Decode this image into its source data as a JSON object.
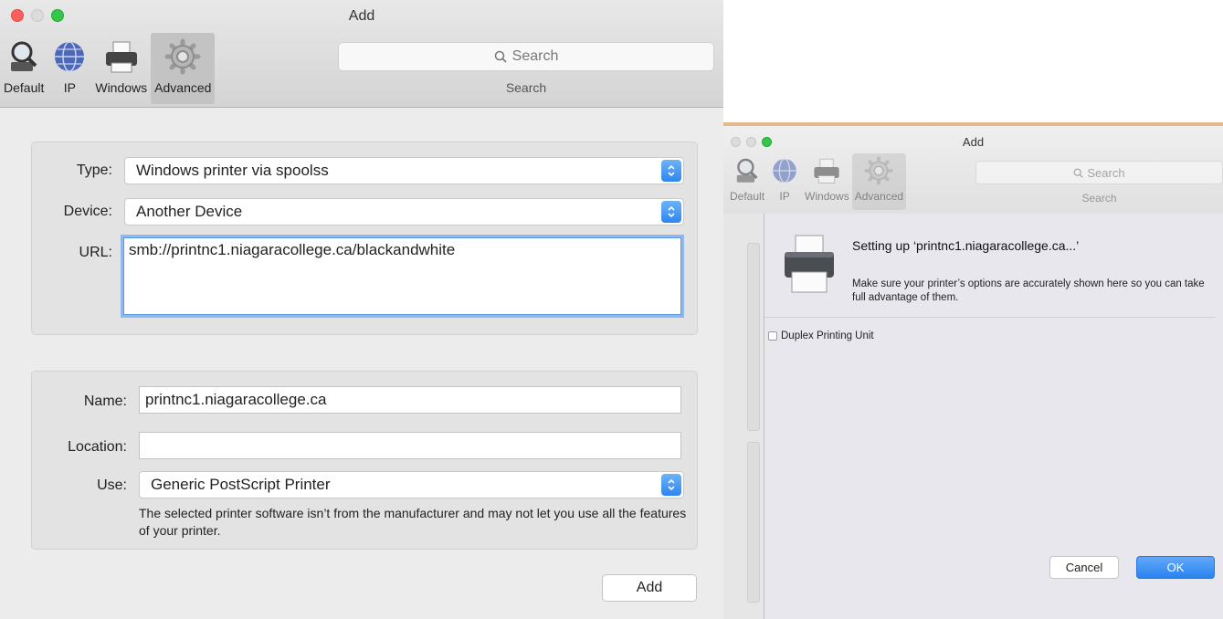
{
  "left_window": {
    "title": "Add",
    "toolbar": [
      {
        "label": "Default",
        "icon": "magnifier-icon"
      },
      {
        "label": "IP",
        "icon": "globe-icon"
      },
      {
        "label": "Windows",
        "icon": "printer-icon"
      },
      {
        "label": "Advanced",
        "icon": "gear-icon",
        "active": true
      }
    ],
    "search": {
      "placeholder": "Search",
      "caption": "Search"
    },
    "type": {
      "label": "Type:",
      "value": "Windows printer via spoolss"
    },
    "device": {
      "label": "Device:",
      "value": "Another Device"
    },
    "url": {
      "label": "URL:",
      "value": "smb://printnc1.niagaracollege.ca/blackandwhite"
    },
    "name": {
      "label": "Name:",
      "value": "printnc1.niagaracollege.ca"
    },
    "location": {
      "label": "Location:",
      "value": ""
    },
    "use": {
      "label": "Use:",
      "value": "Generic PostScript Printer",
      "note": "The selected printer software isn’t from the manufacturer and may not let you use all the features of your printer."
    },
    "add_button": "Add"
  },
  "right_window": {
    "title": "Add",
    "toolbar": [
      {
        "label": "Default",
        "icon": "magnifier-icon"
      },
      {
        "label": "IP",
        "icon": "globe-icon"
      },
      {
        "label": "Windows",
        "icon": "printer-icon"
      },
      {
        "label": "Advanced",
        "icon": "gear-icon",
        "active": true
      }
    ],
    "search": {
      "placeholder": "Search",
      "caption": "Search"
    },
    "sheet": {
      "title": "Setting up ‘printnc1.niagaracollege.ca...’",
      "message": "Make sure your printer’s options are accurately shown here so you can take full advantage of them.",
      "option_label": "Duplex Printing Unit",
      "option_checked": false,
      "cancel_label": "Cancel",
      "ok_label": "OK"
    }
  },
  "colors": {
    "accent_blue": "#2e86f0",
    "close_red": "#fc605c",
    "zoom_green": "#34c84a",
    "focus_ring": "#8fb8ef"
  }
}
